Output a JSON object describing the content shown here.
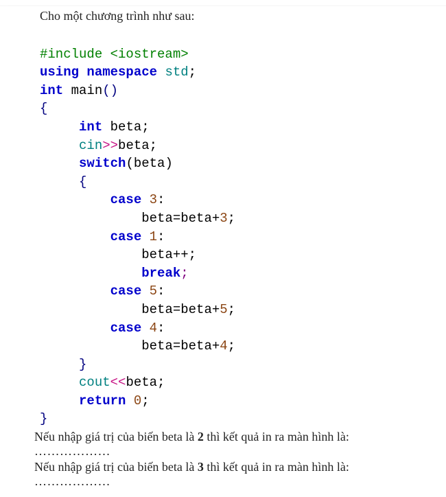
{
  "prompt": "Cho một chương trình như sau:",
  "code": {
    "line1_include": "#include <iostream>",
    "line2_using": "using",
    "line2_namespace": "namespace",
    "line2_std": "std",
    "line2_semi": ";",
    "line3_int": "int",
    "line3_main": "main",
    "line3_paren": "()",
    "line4_brace": "{",
    "line5_int": "int",
    "line5_beta": " beta;",
    "line6_cin": "cin",
    "line6_op": ">>",
    "line6_beta": "beta;",
    "line7_switch": "switch",
    "line7_rest": "(beta)",
    "line8_brace": "{",
    "line9_case": "case",
    "line9_num": " 3",
    "line9_colon": ":",
    "line10_stmt": "beta=beta+",
    "line10_num": "3",
    "line10_semi": ";",
    "line11_case": "case",
    "line11_num": " 1",
    "line11_colon": ":",
    "line12_stmt": "beta++;",
    "line13_break": "break",
    "line13_semi": ";",
    "line14_case": "case",
    "line14_num": " 5",
    "line14_colon": ":",
    "line15_stmt": "beta=beta+",
    "line15_num": "5",
    "line15_semi": ";",
    "line16_case": "case",
    "line16_num": " 4",
    "line16_colon": ":",
    "line17_stmt": "beta=beta+",
    "line17_num": "4",
    "line17_semi": ";",
    "line18_brace": "}",
    "line19_cout": "cout",
    "line19_op": "<<",
    "line19_beta": "beta;",
    "line20_return": "return",
    "line20_num": " 0",
    "line20_semi": ";",
    "line21_brace": "}"
  },
  "question1_pre": "Nếu nhập giá trị của biến beta là ",
  "question1_bold": "2",
  "question1_post": " thì kết quả in ra màn hình là:",
  "dots": "………………",
  "question2_pre": "Nếu nhập giá trị của biến beta là ",
  "question2_bold": "3",
  "question2_post": " thì kết quả in ra màn hình là:"
}
